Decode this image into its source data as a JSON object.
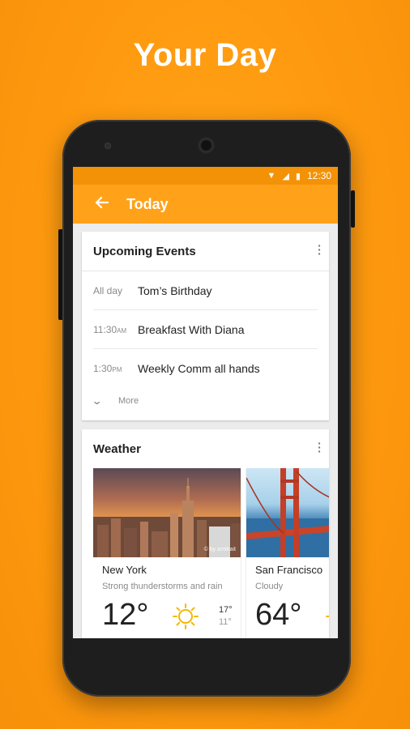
{
  "headline": "Your Day",
  "status": {
    "time": "12:30"
  },
  "appbar": {
    "title": "Today"
  },
  "events": {
    "title": "Upcoming Events",
    "items": [
      {
        "time": "All day",
        "suffix": "",
        "title": "Tom’s Birthday"
      },
      {
        "time": "11:30",
        "suffix": "AM",
        "title": "Breakfast With Diana"
      },
      {
        "time": "1:30",
        "suffix": "PM",
        "title": "Weekly Comm all hands"
      }
    ],
    "more_label": "More"
  },
  "weather": {
    "title": "Weather",
    "cities": [
      {
        "city": "New York",
        "desc": "Strong thunderstorms and rain",
        "temp": "12°",
        "high": "17°",
        "low": "11°",
        "credit": "© by amitrait",
        "icon": "sun-icon"
      },
      {
        "city": "San Francisco",
        "desc": "Cloudy",
        "temp": "64°",
        "icon": "sun-icon"
      }
    ]
  },
  "colors": {
    "accent": "#ffa21a",
    "status_bar": "#f39207",
    "background": "#ff9b10"
  }
}
